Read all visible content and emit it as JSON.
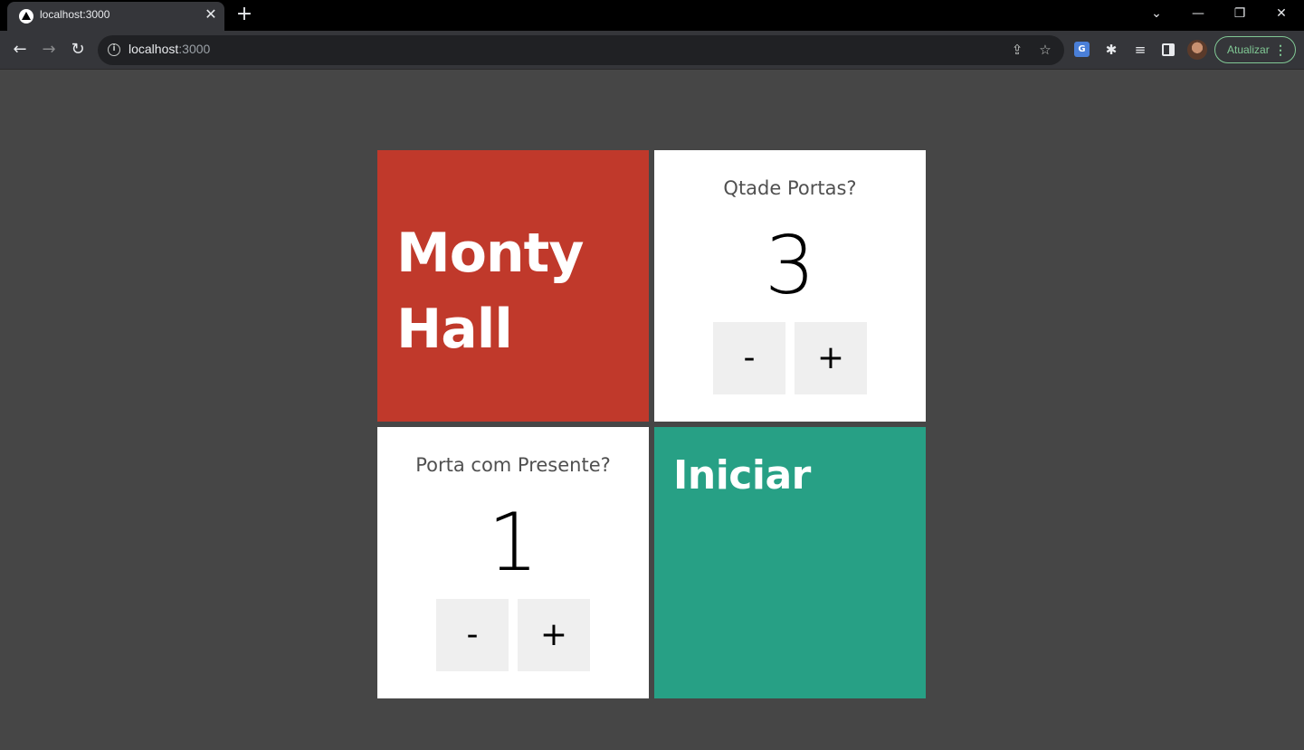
{
  "browser": {
    "tab_title": "localhost:3000",
    "tab_close": "✕",
    "new_tab": "+",
    "url_host": "localhost",
    "url_port": ":3000",
    "update_label": "Atualizar",
    "icons": [
      "back-arrow-icon",
      "forward-arrow-icon",
      "reload-icon",
      "info-icon",
      "share-icon",
      "star-icon",
      "translate-icon",
      "extensions-icon",
      "media-icon",
      "side-panel-icon",
      "avatar",
      "more-icon"
    ]
  },
  "app": {
    "title": "Monty Hall",
    "doors": {
      "label": "Qtade Portas?",
      "value": "3",
      "minus": "-",
      "plus": "+"
    },
    "gift": {
      "label": "Porta com Presente?",
      "value": "1",
      "minus": "-",
      "plus": "+"
    },
    "start_label": "Iniciar",
    "colors": {
      "background": "#464646",
      "title_card": "#c0392b",
      "start_card": "#27a085",
      "panel": "#ffffff",
      "stepper": "#efefef"
    }
  }
}
